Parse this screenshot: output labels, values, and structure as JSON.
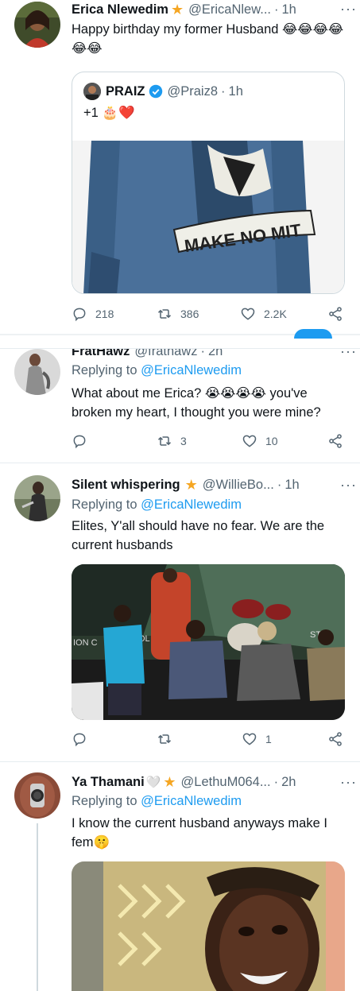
{
  "tweets": [
    {
      "name": "Erica Nlewedim",
      "handle": "@EricaNlew...",
      "time": "1h",
      "more": "···",
      "text": "Happy birthday my former Husband 😂😂😂😂😂😂",
      "quote": {
        "name": "PRAIZ",
        "handle": "@Praiz8",
        "time": "1h",
        "text": "+1 🎂❤️",
        "jacket_text": "MAKE NO MIT"
      },
      "actions": {
        "replies": "218",
        "retweets": "386",
        "likes": "2.2K"
      }
    },
    {
      "name": "FratHawz",
      "handle": "@frathawz",
      "time": "2h",
      "more": "···",
      "replying_label": "Replying to",
      "replying_to": "@EricaNlewedim",
      "text": "What about me Erica? 😭😭😭😭 you've broken my heart, I thought you were mine?",
      "actions": {
        "replies": "",
        "retweets": "3",
        "likes": "10"
      }
    },
    {
      "name": "Silent whispering",
      "handle": "@WillieBo...",
      "time": "1h",
      "more": "···",
      "replying_label": "Replying to",
      "replying_to": "@EricaNlewedim",
      "text": "Elites, Y'all should have no fear.  We are the current  husbands",
      "stage_sign_left": "ION C",
      "stage_sign_mid": "OL",
      "stage_sign_right": "STR",
      "actions": {
        "replies": "",
        "retweets": "",
        "likes": "1"
      }
    },
    {
      "name": "Ya Thamani",
      "heart": "🤍",
      "handle": "@LethuM064...",
      "time": "2h",
      "more": "···",
      "replying_label": "Replying to",
      "replying_to": "@EricaNlewedim",
      "text": "I know the current husband anyways make I fem🤫"
    }
  ],
  "colors": {
    "accent": "#1d9bf0",
    "muted": "#536471",
    "star": "#f5a623",
    "divider": "#e6ecf0"
  }
}
